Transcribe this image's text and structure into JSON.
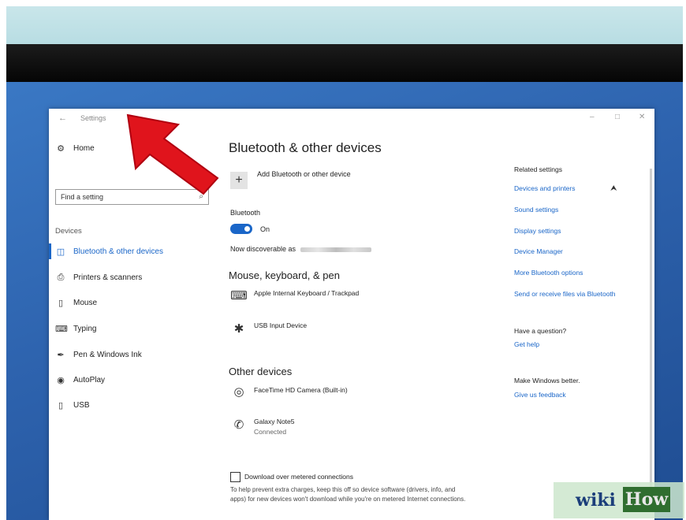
{
  "window": {
    "title": "Settings"
  },
  "sidebar": {
    "home_label": "Home",
    "search_placeholder": "Find a setting",
    "section_label": "Devices",
    "items": [
      {
        "label": "Bluetooth & other devices",
        "icon": "bluetooth-devices-icon",
        "active": true
      },
      {
        "label": "Printers & scanners",
        "icon": "printer-icon"
      },
      {
        "label": "Mouse",
        "icon": "mouse-icon"
      },
      {
        "label": "Typing",
        "icon": "keyboard-icon"
      },
      {
        "label": "Pen & Windows Ink",
        "icon": "pen-icon"
      },
      {
        "label": "AutoPlay",
        "icon": "autoplay-icon"
      },
      {
        "label": "USB",
        "icon": "usb-icon"
      }
    ]
  },
  "main": {
    "title": "Bluetooth & other devices",
    "add_device_label": "Add Bluetooth or other device",
    "bluetooth_heading": "Bluetooth",
    "bluetooth_state": "On",
    "discoverable_label": "Now discoverable as",
    "mouse_keyboard_heading": "Mouse, keyboard, & pen",
    "mouse_keyboard_devices": [
      {
        "name": "Apple Internal Keyboard / Trackpad",
        "icon": "keyboard-icon"
      },
      {
        "name": "USB Input Device",
        "icon": "bluetooth-icon"
      }
    ],
    "other_devices_heading": "Other devices",
    "other_devices": [
      {
        "name": "FaceTime HD Camera (Built-in)",
        "icon": "webcam-icon",
        "status": ""
      },
      {
        "name": "Galaxy Note5",
        "icon": "phone-icon",
        "status": "Connected"
      }
    ],
    "metered_checkbox_label": "Download over metered connections",
    "metered_help_text": "To help prevent extra charges, keep this off so device software (drivers, info, and apps) for new devices won't download while you're on metered Internet connections."
  },
  "related": {
    "heading": "Related settings",
    "links": [
      "Devices and printers",
      "Sound settings",
      "Display settings",
      "Device Manager",
      "More Bluetooth options",
      "Send or receive files via Bluetooth"
    ],
    "question_heading": "Have a question?",
    "get_help": "Get help",
    "better_heading": "Make Windows better.",
    "feedback": "Give us feedback"
  },
  "watermark": {
    "wiki": "wiki",
    "how": "How"
  },
  "colors": {
    "accent": "#1a66c8",
    "arrow": "#e0141c"
  }
}
